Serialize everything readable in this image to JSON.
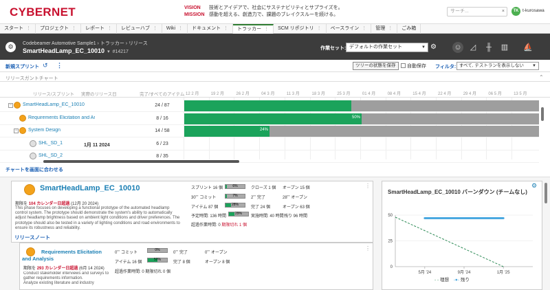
{
  "brand": {
    "logo": "CYBERNET"
  },
  "vision": {
    "label": "VISION",
    "text": "技術とアイデアで、社会にサステナビリティとサプライズを。"
  },
  "mission": {
    "label": "MISSION",
    "text": "感動を超える、創造力で、課題のブレイクスルーを続ける。"
  },
  "search": {
    "placeholder": "サーチ..."
  },
  "user": {
    "initials": "TK",
    "name": "t-kurosawa"
  },
  "tabs": [
    {
      "label": "スタート"
    },
    {
      "label": "プロジェクト"
    },
    {
      "label": "レポート"
    },
    {
      "label": "レビューハブ"
    },
    {
      "label": "Wiki"
    },
    {
      "label": "ドキュメント"
    },
    {
      "label": "トラッカー"
    },
    {
      "label": "SCM リポジトリ"
    },
    {
      "label": "ベースライン"
    },
    {
      "label": "管理"
    },
    {
      "label": "ごみ箱"
    }
  ],
  "header": {
    "breadcrumb": "Codebeamer Automotive Sample1 › トラッカー › リリース",
    "title": "SmartHeadLamp_EC_10010",
    "id": "#14217",
    "workset_label": "作業セット:",
    "workset_value": "デフォルトの作業セット"
  },
  "toolbar": {
    "new_sprint": "新規スプリント",
    "save_state": "ツリーの状態を保存",
    "auto_save": "自動保存",
    "filter_label": "フィルタ:",
    "filter_value": "すべて, テストランを表示しない"
  },
  "gantt": {
    "section_title": "リリースガントチャート",
    "col_release": "リリース/スプリント",
    "col_date": "実際のリリース日",
    "col_count": "完了/すべてのアイテム",
    "dates": [
      "12 2 月",
      "19 2 月",
      "26 2 月",
      "04 3 月",
      "11 3 月",
      "18 3 月",
      "25 3 月",
      "01 4 月",
      "08 4 月",
      "15 4 月",
      "22 4 月",
      "29 4 月",
      "06 5 月",
      "13 5 月"
    ],
    "rows": [
      {
        "name": "SmartHeadLamp_EC_10010",
        "date": "",
        "count": "24 / 87",
        "progress": 0.47,
        "pct_label": ""
      },
      {
        "name": "Requirements Elicitation and Ana",
        "date": "",
        "count": "8 / 16",
        "progress": 0.5,
        "pct_label": "50%"
      },
      {
        "name": "System Design",
        "date": "",
        "count": "14 / 58",
        "progress": 0.24,
        "pct_label": "24%"
      },
      {
        "name": "SHL_SD_1",
        "date": "1月 11 2024",
        "count": "6 / 23",
        "progress": 0,
        "pct_label": ""
      },
      {
        "name": "SHL_SD_2",
        "date": "",
        "count": "8 / 35",
        "progress": 0,
        "pct_label": ""
      }
    ],
    "fit_link": "チャートを画面に合わせる"
  },
  "card1": {
    "title": "SmartHeadLamp_EC_10010",
    "due_prefix": "期限を",
    "due_overdue": "104 カレンダー日超過",
    "due_suffix": "(12月 20 2024)",
    "description": "This phase focuses on developing a functional prototype of the automated headlamp control system. The prototype should demonstrate the system's ability to automatically adjust headlamp brightness based on ambient light conditions and driver preferences. The prototype should also be tested in a variety of lighting conditions and road environments to ensure its robustness and reliability.",
    "release_note": "リリースノート",
    "stats": {
      "sprint": "スプリント 16 個",
      "sprint_bar": "6%",
      "sprint_fill": 0.06,
      "closed": "クローズ 1 個",
      "open": "オープン 15 個",
      "commit": "30˚˚ コミット",
      "commit_bar": "7%",
      "commit_fill": 0.07,
      "done2": "2˚˚ 完了",
      "open2": "28˚˚ オープン",
      "items": "アイテム 87 個",
      "items_bar": "28%",
      "items_fill": 0.28,
      "done_items": "完了 24 個",
      "open_items": "オープン 63 個",
      "planned": "予定時間: 136 時間",
      "planned_bar": "29%",
      "planned_fill": 0.29,
      "actual": "実施時間: 40 時間",
      "remaining": "残り 96 時間",
      "overtime": "超過作業時間: 0",
      "overdue": "期限切れ 1 個"
    }
  },
  "card2": {
    "title": "Requirements Elicitation and Analysis",
    "due_prefix": "期限を",
    "due_overdue": "293 カレンダー日超過",
    "due_suffix": "(6月 14 2024)",
    "description": "Conduct stakeholder interviews and surveys to gather requirements information.\nAnalyze existing literature and industry",
    "stats": {
      "commit": "0˚˚ コミット",
      "commit_bar": "0%",
      "commit_fill": 0,
      "done": "0˚˚ 完了",
      "open": "0˚˚ オープン",
      "items": "アイテム 16 個",
      "items_bar": "50%",
      "items_fill": 0.5,
      "done_items": "完了 8 個",
      "open_items": "オープン 8 個",
      "overtime": "超過作業時間: 0 期限切れ 0 個"
    }
  },
  "burndown": {
    "title": "SmartHeadLamp_EC_10010 バーンダウン (チームなし)",
    "legend_ideal": "理想",
    "legend_remaining": "残り"
  },
  "chart_data": {
    "type": "line",
    "title": "SmartHeadLamp_EC_10010 バーンダウン (チームなし)",
    "xlabel": "",
    "ylabel": "",
    "ylim": [
      0,
      50
    ],
    "yticks": [
      0,
      25,
      50
    ],
    "xticks": [
      "5月 '24",
      "9月 '24",
      "1月 '25"
    ],
    "series": [
      {
        "name": "理想",
        "style": "dashed",
        "color": "#2e8b57",
        "x": [
          "2024-02",
          "2025-01"
        ],
        "y": [
          48,
          0
        ]
      },
      {
        "name": "残り",
        "style": "solid",
        "color": "#4aa8e0",
        "x": [
          "2024-05",
          "2025-01"
        ],
        "y": [
          47,
          47
        ]
      }
    ]
  },
  "colors": {
    "accent": "#c8102e",
    "progress": "#1ba35b",
    "link": "#1a7fb4",
    "header_bg": "#3c3c3c"
  }
}
